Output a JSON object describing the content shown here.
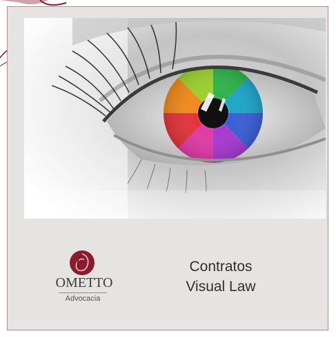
{
  "slide": {
    "image_description_icon": "eye-image",
    "logo": {
      "name": "OMETTO",
      "subtitle": "Advocacia"
    },
    "title": {
      "line1": "Contratos",
      "line2": "Visual Law"
    }
  },
  "colors": {
    "card_background": "#e6e3e3",
    "card_border": "#b98a93",
    "brand_maroon": "#8c1c2c",
    "text": "#2e2e2e"
  }
}
